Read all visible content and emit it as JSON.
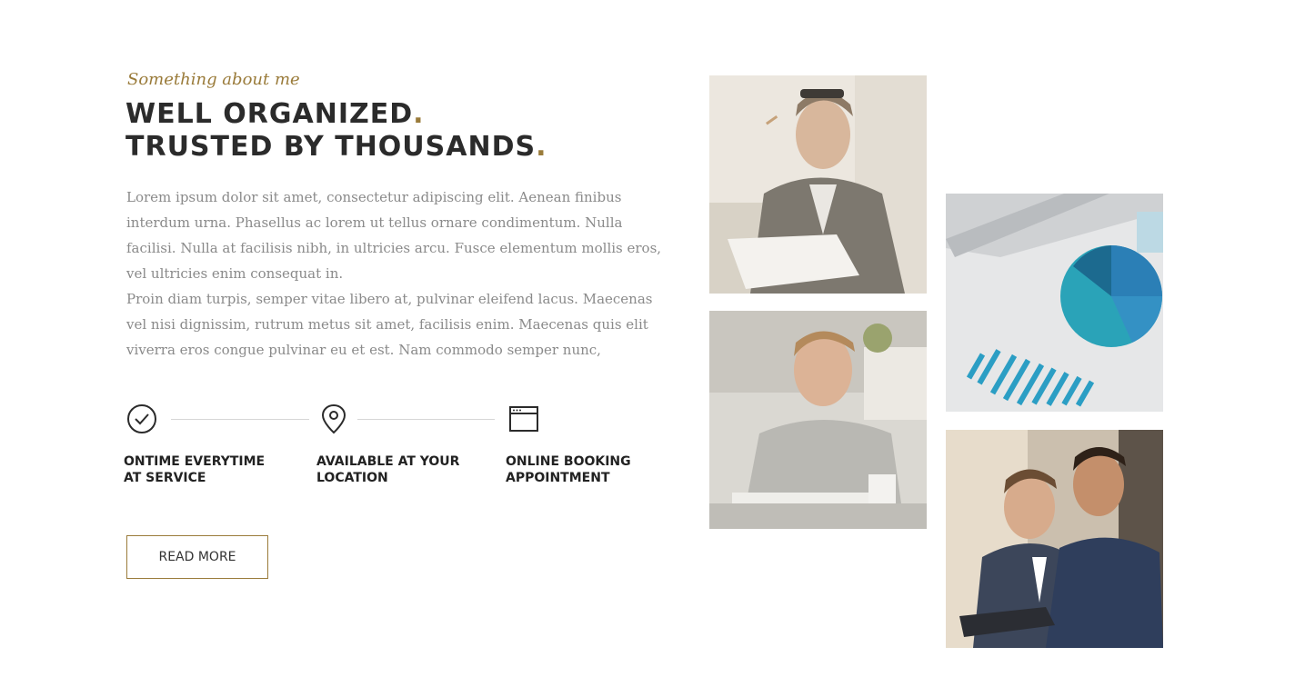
{
  "about": {
    "subtitle": "Something about me",
    "heading_line1": "WELL ORGANIZED",
    "heading_line2": "TRUSTED BY THOUSANDS",
    "heading_dot": ".",
    "paragraph1": "Lorem ipsum dolor sit amet, consectetur adipiscing elit. Aenean finibus interdum urna. Phasellus ac lorem ut tellus ornare condimentum. Nulla facilisi. Nulla at facilisis nibh, in ultricies arcu. Fusce elementum mollis eros, vel ultricies enim consequat in.",
    "paragraph2": "Proin diam turpis, semper vitae libero at, pulvinar eleifend lacus. Maecenas vel nisi dignissim, rutrum metus sit amet, facilisis enim. Maecenas quis elit viverra eros congue pulvinar eu et est. Nam commodo semper nunc,"
  },
  "features": [
    {
      "icon": "check-circle-icon",
      "line1": "ONTIME EVERYTIME",
      "line2": "AT SERVICE"
    },
    {
      "icon": "map-pin-icon",
      "line1": "AVAILABLE AT YOUR",
      "line2": "LOCATION"
    },
    {
      "icon": "browser-window-icon",
      "line1": "ONLINE BOOKING",
      "line2": "APPOINTMENT"
    }
  ],
  "read_more_label": "READ MORE",
  "photos": [
    {
      "name": "photo-man-reading-documents"
    },
    {
      "name": "photo-man-at-desk"
    },
    {
      "name": "photo-tablet-pie-chart"
    },
    {
      "name": "photo-two-businessmen-tablet"
    }
  ],
  "colors": {
    "accent": "#9a7b3a",
    "heading": "#2b2b2b",
    "body_text": "#8a8a8a"
  }
}
